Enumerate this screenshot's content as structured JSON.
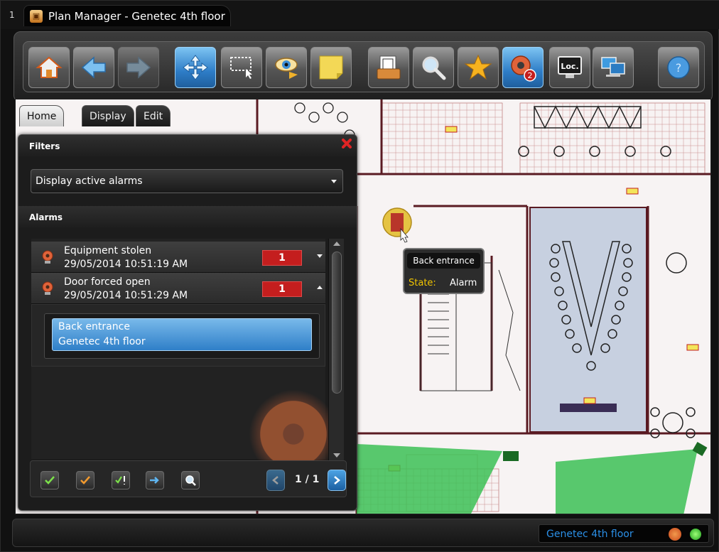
{
  "window": {
    "tab_number": "1",
    "title": "Plan Manager - Genetec 4th floor"
  },
  "toolbar": {
    "buttons": [
      {
        "icon": "home-icon",
        "active": false
      },
      {
        "icon": "back-arrow-icon",
        "active": false
      },
      {
        "icon": "forward-arrow-icon",
        "active": false
      },
      {
        "icon": "pan-icon",
        "active": true
      },
      {
        "icon": "select-area-icon",
        "active": false
      },
      {
        "icon": "monitor-eye-icon",
        "active": false
      },
      {
        "icon": "sticky-note-icon",
        "active": false
      },
      {
        "icon": "map-archive-icon",
        "active": false
      },
      {
        "icon": "search-icon",
        "active": false
      },
      {
        "icon": "favorite-star-icon",
        "active": false
      },
      {
        "icon": "alarm-siren-icon",
        "active": true,
        "badge": "2"
      },
      {
        "icon": "locate-monitor-icon",
        "active": false,
        "label": "Loc."
      },
      {
        "icon": "network-monitors-icon",
        "active": false
      },
      {
        "icon": "help-icon",
        "active": false
      }
    ]
  },
  "subtabs": {
    "home": "Home",
    "display": "Display",
    "edit": "Edit"
  },
  "panel": {
    "filters_heading": "Filters",
    "filter_value": "Display active alarms",
    "alarms_heading": "Alarms",
    "alarms": [
      {
        "name": "Equipment stolen",
        "time": "29/05/2014 10:51:19 AM",
        "count": "1",
        "expanded": false
      },
      {
        "name": "Door forced open",
        "time": "29/05/2014 10:51:29 AM",
        "count": "1",
        "expanded": true
      }
    ],
    "details": [
      "Back entrance",
      "Genetec 4th floor"
    ],
    "pagination": "1 / 1"
  },
  "tooltip": {
    "title": "Back entrance",
    "state_label": "State:",
    "state_value": "Alarm"
  },
  "status_bar": {
    "location": "Genetec 4th floor"
  },
  "colors": {
    "accent_blue": "#2e7dc7",
    "alarm_red": "#c41e1e",
    "camera_green": "#34b04a",
    "state_yellow": "#f2c500"
  }
}
